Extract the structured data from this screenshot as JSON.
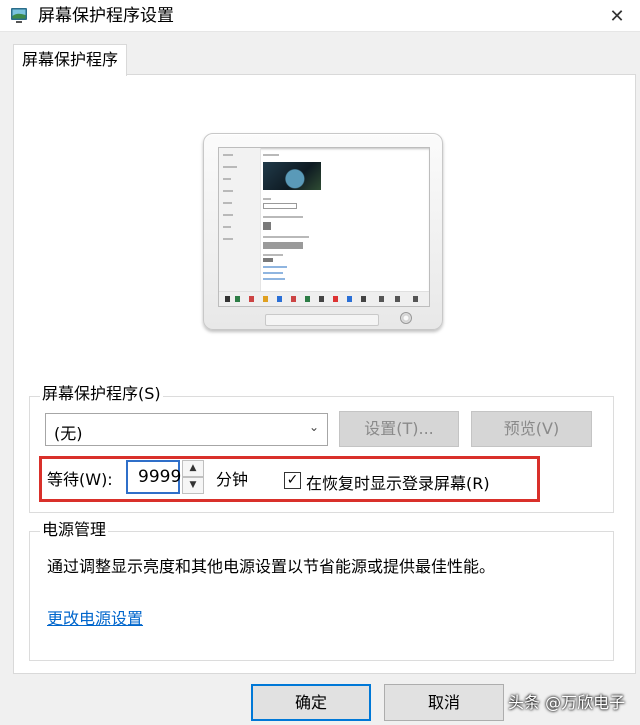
{
  "window": {
    "title": "屏幕保护程序设置",
    "icon": "screensaver-monitor-icon",
    "close_glyph": "✕"
  },
  "tabs": [
    {
      "label": "屏幕保护程序",
      "active": true
    }
  ],
  "screensaver": {
    "group_label": "屏幕保护程序(S)",
    "selected": "(无)",
    "settings_button": "设置(T)...",
    "preview_button": "预览(V)",
    "wait_label": "等待(W):",
    "wait_value": "9999",
    "minutes_label": "分钟",
    "show_logon_checked": true,
    "show_logon_label": "在恢复时显示登录屏幕(R)",
    "highlight_color": "#d9302a"
  },
  "power": {
    "group_label": "电源管理",
    "description": "通过调整显示亮度和其他电源设置以节省能源或提供最佳性能。",
    "link": "更改电源设置"
  },
  "footer": {
    "ok_button": "确定",
    "cancel_button": "取消"
  },
  "watermark": "头条 @万欣电子",
  "colors": {
    "accent": "#0078d7",
    "link": "#0066cc"
  }
}
